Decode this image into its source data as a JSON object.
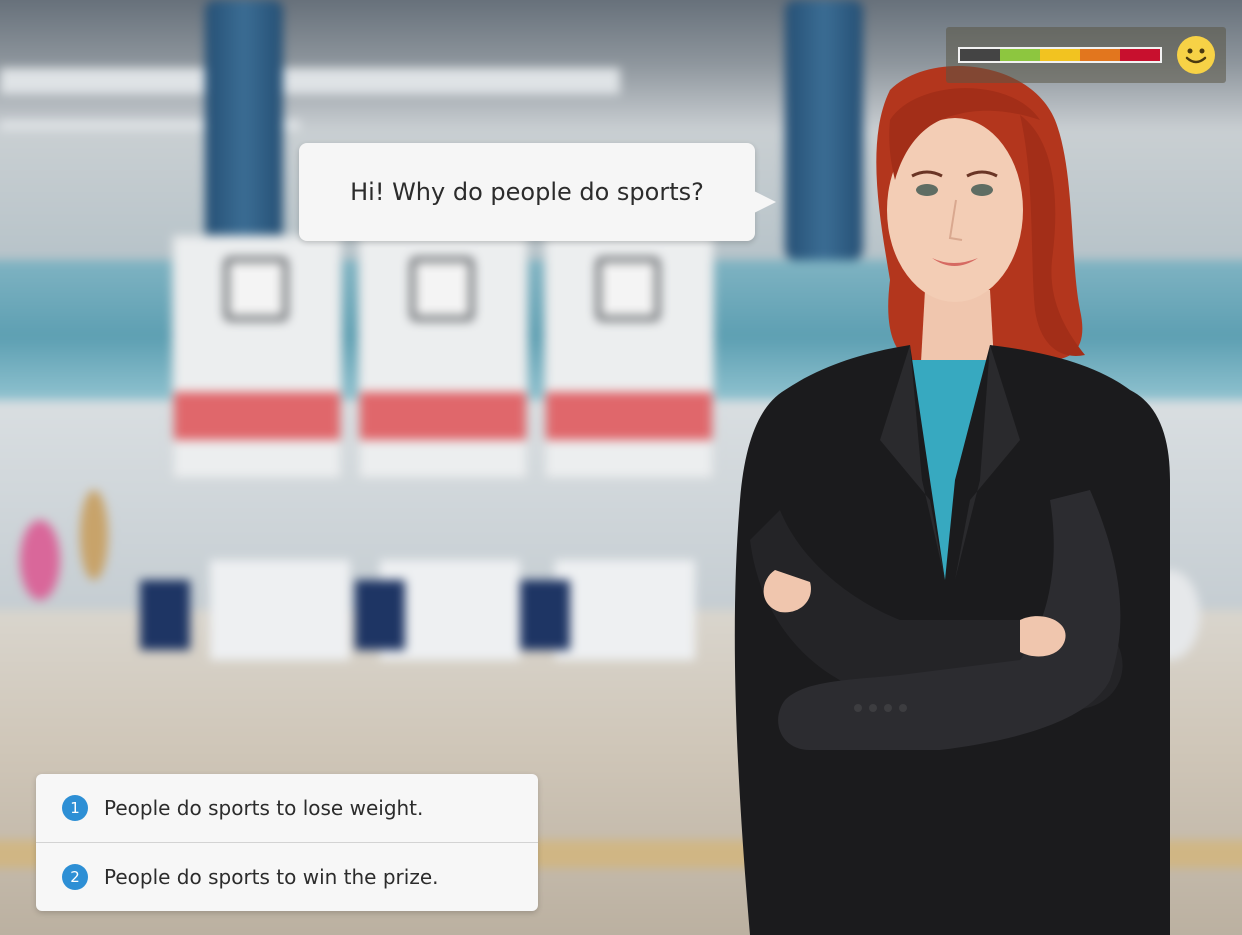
{
  "dialog": {
    "speech": "Hi! Why do people do sports?"
  },
  "answers": [
    {
      "number": "1",
      "text": "People do sports to lose weight."
    },
    {
      "number": "2",
      "text": "People do sports to win the prize."
    }
  ],
  "mood_meter": {
    "segment_colors": [
      "#444444",
      "#8dc63f",
      "#f2c320",
      "#e2761e",
      "#c8102e"
    ],
    "face_icon": "smiley-face-icon",
    "face_color": "#f7d246"
  },
  "colors": {
    "answer_badge": "#2d8fd5",
    "blazer": "#1b1b1d",
    "hair": "#b3361d",
    "top": "#37a9c0"
  }
}
